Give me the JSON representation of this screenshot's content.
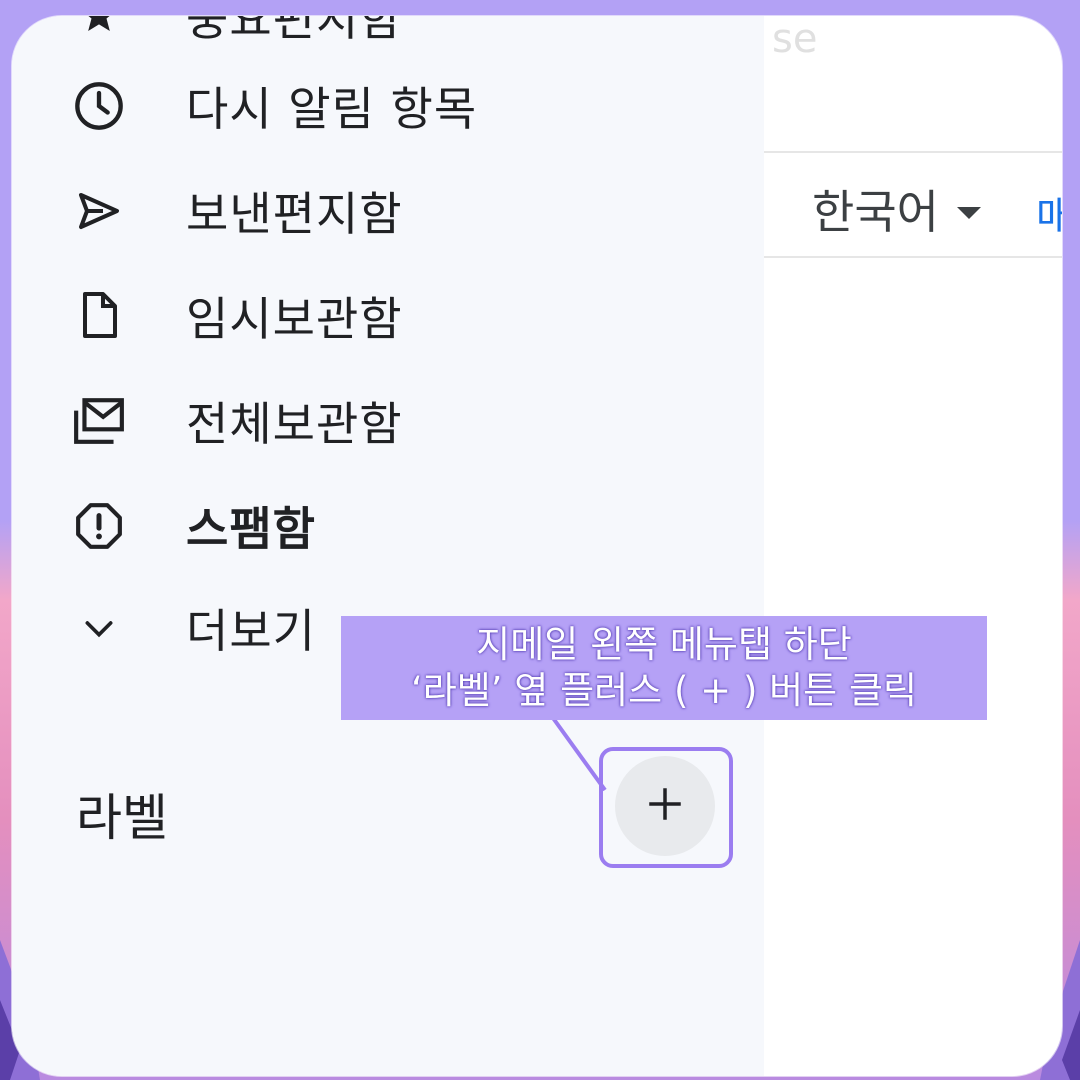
{
  "sidebar": {
    "items": [
      {
        "label": "중요편지함",
        "icon": "star-icon",
        "bold": false
      },
      {
        "label": "다시 알림 항목",
        "icon": "clock-icon",
        "bold": false
      },
      {
        "label": "보낸편지함",
        "icon": "send-icon",
        "bold": false
      },
      {
        "label": "임시보관함",
        "icon": "draft-icon",
        "bold": false
      },
      {
        "label": "전체보관함",
        "icon": "all-mail-icon",
        "bold": false
      },
      {
        "label": "스팸함",
        "icon": "spam-icon",
        "bold": true
      },
      {
        "label": "더보기",
        "icon": "chevron-down-icon",
        "bold": false
      }
    ],
    "labels_title": "라벨",
    "add_label_icon": "plus-icon"
  },
  "topbar": {
    "language": "한국어",
    "next_link": "매"
  },
  "callout": {
    "line1": "지메일 왼쪽 메뉴탭 하단",
    "line2": "‘라벨’ 옆 플러스 ( + ) 버튼 클릭"
  },
  "colors": {
    "accent": "#9b7df0",
    "callout_bg": "#b5a1f6",
    "sidebar_bg": "#f6f8fc",
    "link": "#1a73e8"
  }
}
